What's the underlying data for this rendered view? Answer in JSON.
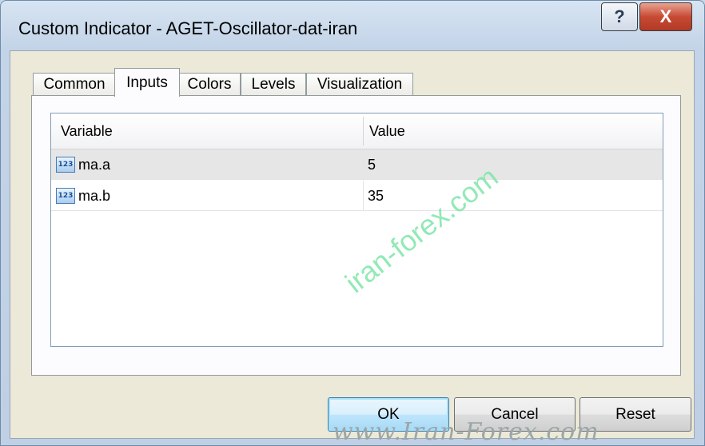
{
  "window": {
    "title": "Custom Indicator - AGET-Oscillator-dat-iran",
    "help_label": "?",
    "close_label": "X"
  },
  "tabs": [
    {
      "label": "Common"
    },
    {
      "label": "Inputs"
    },
    {
      "label": "Colors"
    },
    {
      "label": "Levels"
    },
    {
      "label": "Visualization"
    }
  ],
  "active_tab": "Inputs",
  "table": {
    "headers": {
      "variable": "Variable",
      "value": "Value"
    },
    "rows": [
      {
        "icon": "123",
        "variable": "ma.a",
        "value": "5"
      },
      {
        "icon": "123",
        "variable": "ma.b",
        "value": "35"
      }
    ]
  },
  "buttons": {
    "ok": "OK",
    "cancel": "Cancel",
    "reset": "Reset"
  },
  "watermark": "iran-forex.com",
  "footer_watermark": "www.Iran-Forex.com",
  "colors": {
    "close_button": "#c74a34",
    "watermark": "#7fe6a9",
    "selected_row": "#e6e6e6"
  }
}
